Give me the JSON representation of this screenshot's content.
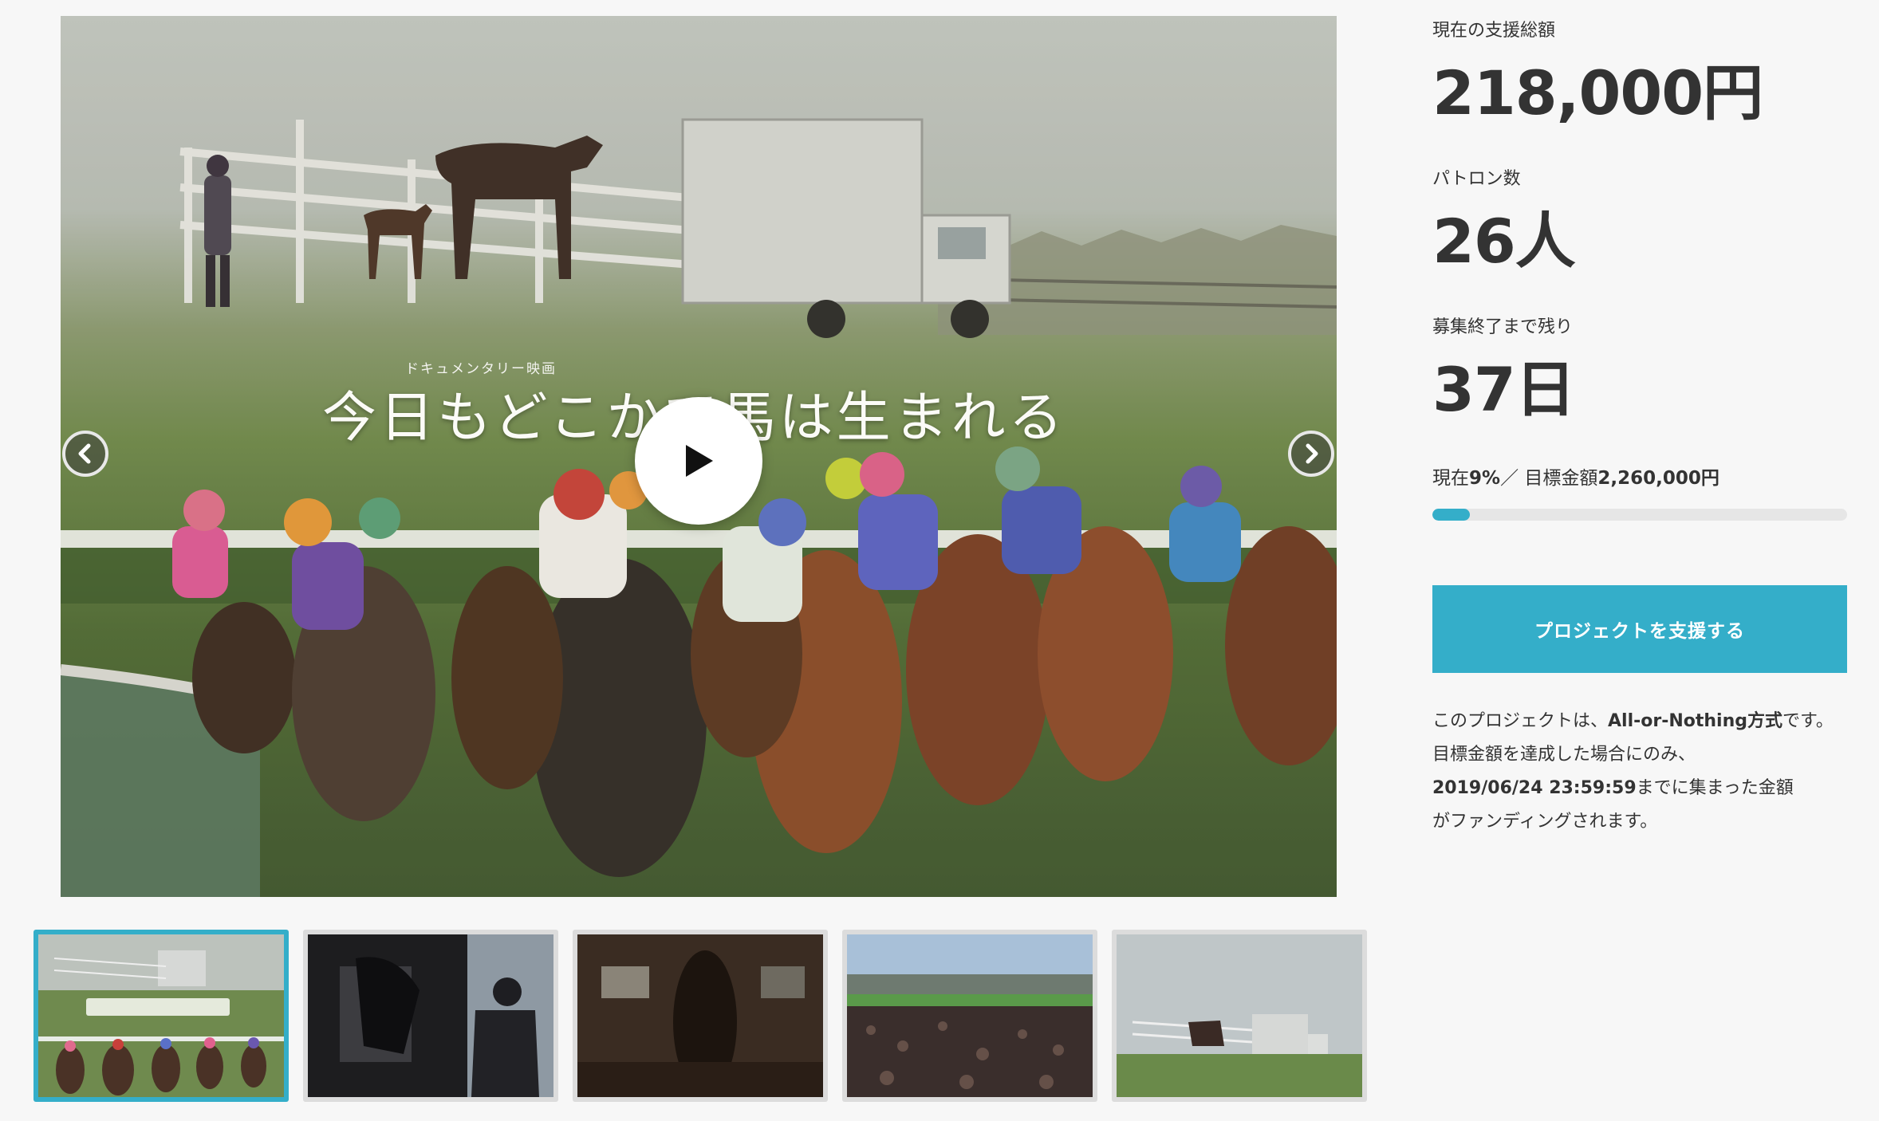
{
  "hero": {
    "subtitle": "ドキュメンタリー映画",
    "title": "今日もどこかで馬は生まれる",
    "play_icon": "play-icon",
    "prev_icon": "chevron-left-icon",
    "next_icon": "chevron-right-icon"
  },
  "thumbnails": {
    "active_index": 0,
    "count": 5
  },
  "stats": {
    "total_label": "現在の支援総額",
    "total_value": "218,000円",
    "patrons_label": "パトロン数",
    "patrons_value": "26人",
    "remaining_label": "募集終了まで残り",
    "remaining_value": "37日"
  },
  "progress": {
    "prefix": "現在",
    "percent_text": "9%",
    "separator": "／ 目標金額",
    "goal_text": "2,260,000円",
    "fraction": 0.09
  },
  "support_button": {
    "label": "プロジェクトを支援する"
  },
  "note": {
    "line1_a": "このプロジェクトは、",
    "line1_b": "All-or-Nothing方式",
    "line1_c": "です。",
    "line2": "目標金額を達成した場合にのみ、",
    "deadline": "2019/06/24 23:59:59",
    "line3_rest": "までに集まった金額",
    "line4": "がファンディングされます。"
  },
  "colors": {
    "accent": "#34aec9",
    "text": "#333333",
    "background": "#f7f7f7"
  }
}
